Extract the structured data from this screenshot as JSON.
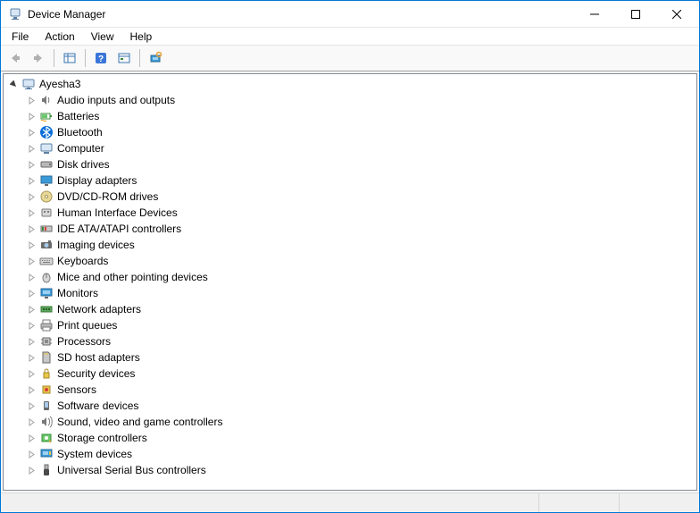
{
  "window": {
    "title": "Device Manager"
  },
  "menubar": {
    "items": [
      {
        "label": "File"
      },
      {
        "label": "Action"
      },
      {
        "label": "View"
      },
      {
        "label": "Help"
      }
    ]
  },
  "toolbar": {
    "buttons": [
      {
        "name": "back-icon"
      },
      {
        "name": "forward-icon"
      },
      {
        "sep": true
      },
      {
        "name": "show-hide-console-tree-icon"
      },
      {
        "sep": true
      },
      {
        "name": "help-icon"
      },
      {
        "name": "properties-icon"
      },
      {
        "sep": true
      },
      {
        "name": "scan-hardware-icon"
      }
    ]
  },
  "tree": {
    "root": {
      "label": "Ayesha3",
      "expanded": true,
      "icon": "computer-root-icon"
    },
    "children": [
      {
        "label": "Audio inputs and outputs",
        "icon": "speaker-icon"
      },
      {
        "label": "Batteries",
        "icon": "battery-icon"
      },
      {
        "label": "Bluetooth",
        "icon": "bluetooth-icon"
      },
      {
        "label": "Computer",
        "icon": "computer-icon"
      },
      {
        "label": "Disk drives",
        "icon": "disk-icon"
      },
      {
        "label": "Display adapters",
        "icon": "display-icon"
      },
      {
        "label": "DVD/CD-ROM drives",
        "icon": "cdrom-icon"
      },
      {
        "label": "Human Interface Devices",
        "icon": "hid-icon"
      },
      {
        "label": "IDE ATA/ATAPI controllers",
        "icon": "ide-icon"
      },
      {
        "label": "Imaging devices",
        "icon": "imaging-icon"
      },
      {
        "label": "Keyboards",
        "icon": "keyboard-icon"
      },
      {
        "label": "Mice and other pointing devices",
        "icon": "mouse-icon"
      },
      {
        "label": "Monitors",
        "icon": "monitor-icon"
      },
      {
        "label": "Network adapters",
        "icon": "network-icon"
      },
      {
        "label": "Print queues",
        "icon": "printer-icon"
      },
      {
        "label": "Processors",
        "icon": "processor-icon"
      },
      {
        "label": "SD host adapters",
        "icon": "sd-icon"
      },
      {
        "label": "Security devices",
        "icon": "security-icon"
      },
      {
        "label": "Sensors",
        "icon": "sensor-icon"
      },
      {
        "label": "Software devices",
        "icon": "software-icon"
      },
      {
        "label": "Sound, video and game controllers",
        "icon": "sound-icon"
      },
      {
        "label": "Storage controllers",
        "icon": "storage-icon"
      },
      {
        "label": "System devices",
        "icon": "system-icon"
      },
      {
        "label": "Universal Serial Bus controllers",
        "icon": "usb-icon"
      }
    ]
  }
}
